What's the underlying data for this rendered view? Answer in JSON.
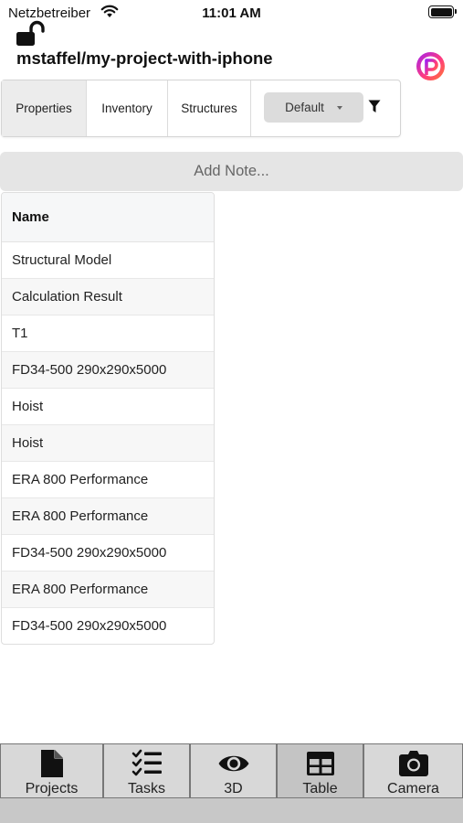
{
  "status_bar": {
    "carrier": "Netzbetreiber",
    "time": "11:01 AM",
    "battery_level": 1.0
  },
  "header": {
    "lock_icon": "unlocked-padlock-icon",
    "project_path": "mstaffel/my-project-with-iphone",
    "logo_icon": "app-logo-icon",
    "colors": {
      "logo_gradient": [
        "#a020f0",
        "#ff3b7f",
        "#ff7a2f"
      ]
    }
  },
  "tabs": [
    {
      "label": "Properties",
      "active": true
    },
    {
      "label": "Inventory",
      "active": false
    },
    {
      "label": "Structures",
      "active": false
    }
  ],
  "filter": {
    "selected_preset": "Default",
    "filter_icon": "filter-funnel-icon"
  },
  "add_note": {
    "label": "Add Note..."
  },
  "table": {
    "columns": [
      "Name"
    ],
    "rows": [
      "Structural Model",
      "Calculation Result",
      "T1",
      "FD34-500 290x290x5000",
      "Hoist",
      "Hoist",
      "ERA 800 Performance",
      "ERA 800 Performance",
      "FD34-500 290x290x5000",
      "ERA 800 Performance",
      "FD34-500 290x290x5000"
    ]
  },
  "bottom_nav": [
    {
      "label": "Projects",
      "icon": "document-icon",
      "active": false
    },
    {
      "label": "Tasks",
      "icon": "checklist-icon",
      "active": false
    },
    {
      "label": "3D",
      "icon": "eye-icon",
      "active": false
    },
    {
      "label": "Table",
      "icon": "table-icon",
      "active": true
    },
    {
      "label": "Camera",
      "icon": "camera-icon",
      "active": false
    }
  ]
}
